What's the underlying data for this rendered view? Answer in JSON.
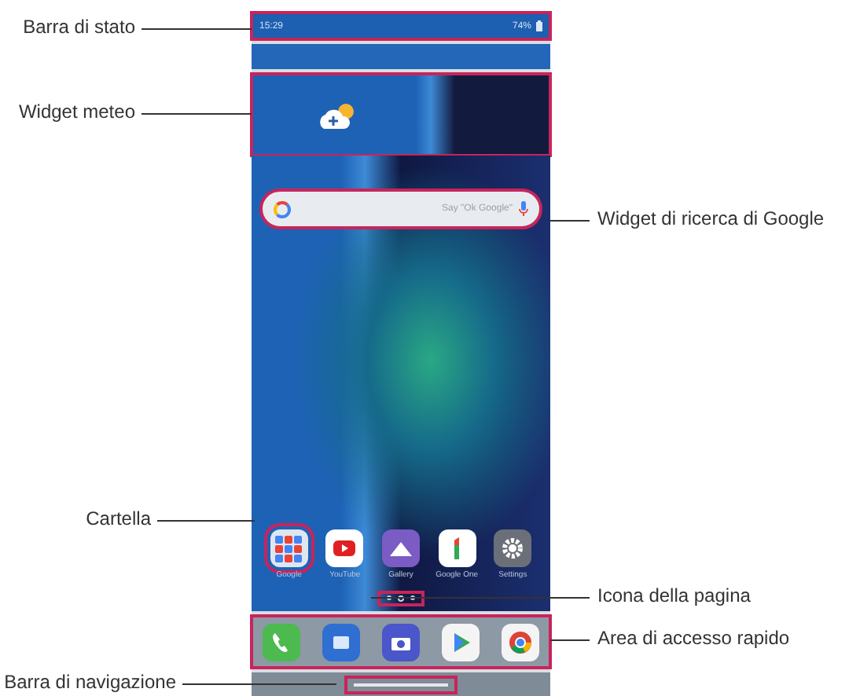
{
  "status_bar": {
    "time": "15:29",
    "battery": "74%"
  },
  "search_widget": {
    "placeholder": "Say \"Ok Google\""
  },
  "apps": [
    {
      "label": "Google",
      "kind": "folder"
    },
    {
      "label": "YouTube",
      "kind": "youtube"
    },
    {
      "label": "Gallery",
      "kind": "gallery"
    },
    {
      "label": "Google One",
      "kind": "one"
    },
    {
      "label": "Settings",
      "kind": "settings"
    }
  ],
  "dock": [
    {
      "kind": "phone"
    },
    {
      "kind": "messages"
    },
    {
      "kind": "camera"
    },
    {
      "kind": "play"
    },
    {
      "kind": "chrome"
    }
  ],
  "callouts": [
    {
      "label": "Barra di stato",
      "kind": "left"
    },
    {
      "label": "Widget meteo",
      "kind": "left"
    },
    {
      "label": "Widget di ricerca di Google",
      "kind": "right"
    },
    {
      "label": "Cartella",
      "kind": "left"
    },
    {
      "label": "Icona della pagina",
      "kind": "right"
    },
    {
      "label": "Area di accesso rapido",
      "kind": "right"
    },
    {
      "label": "Barra di navigazione",
      "kind": "left"
    }
  ]
}
